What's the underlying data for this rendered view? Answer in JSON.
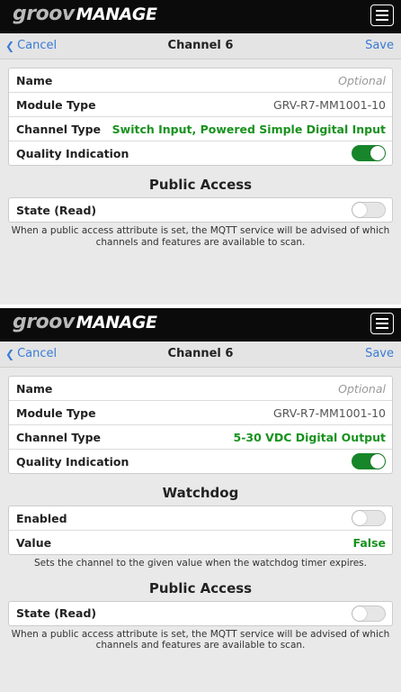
{
  "colors": {
    "accent_blue": "#3a7bd5",
    "value_green": "#18921e",
    "toggle_on": "#17852a",
    "header_bg": "#0b0b0b"
  },
  "screens": [
    {
      "logo": {
        "groov": "groov",
        "manage": "MANAGE"
      },
      "nav": {
        "cancel": "Cancel",
        "title": "Channel 6",
        "save": "Save"
      },
      "fields": {
        "name_label": "Name",
        "name_placeholder": "Optional",
        "module_label": "Module Type",
        "module_value": "GRV-R7-MM1001-10",
        "channel_label": "Channel Type",
        "channel_value": "Switch Input, Powered Simple Digital Input",
        "quality_label": "Quality Indication",
        "quality_on": true
      },
      "public_access": {
        "title": "Public Access",
        "state_label": "State (Read)",
        "state_on": false,
        "note": "When a public access attribute is set, the MQTT service will be advised of which channels and features are available to scan."
      }
    },
    {
      "logo": {
        "groov": "groov",
        "manage": "MANAGE"
      },
      "nav": {
        "cancel": "Cancel",
        "title": "Channel 6",
        "save": "Save"
      },
      "fields": {
        "name_label": "Name",
        "name_placeholder": "Optional",
        "module_label": "Module Type",
        "module_value": "GRV-R7-MM1001-10",
        "channel_label": "Channel Type",
        "channel_value": "5-30 VDC Digital Output",
        "quality_label": "Quality Indication",
        "quality_on": true
      },
      "watchdog": {
        "title": "Watchdog",
        "enabled_label": "Enabled",
        "enabled_on": false,
        "value_label": "Value",
        "value_value": "False",
        "note": "Sets the channel to the given value when the watchdog timer expires."
      },
      "public_access": {
        "title": "Public Access",
        "state_label": "State (Read)",
        "state_on": false,
        "note": "When a public access attribute is set, the MQTT service will be advised of which channels and features are available to scan."
      }
    }
  ]
}
